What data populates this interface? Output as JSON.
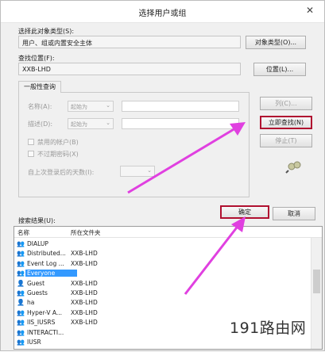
{
  "window": {
    "title": "选择用户或组",
    "close_glyph": "✕"
  },
  "object_type": {
    "label": "选择此对象类型(S):",
    "value": "用户、组或内置安全主体",
    "button": "对象类型(O)..."
  },
  "location": {
    "label": "查找位置(F):",
    "value": "XXB-LHD",
    "button": "位置(L)..."
  },
  "query": {
    "tab_label": "一般性查询",
    "name_label": "名称(A):",
    "name_mode": "起始为",
    "desc_label": "描述(D):",
    "desc_mode": "起始为",
    "disabled_accounts": "禁用的帐户(B)",
    "non_expiring_pw": "不过期密码(X)",
    "days_since_logon": "自上次登录后的天数(I):"
  },
  "side_buttons": {
    "columns": "列(C)...",
    "find_now": "立即查找(N)",
    "stop": "停止(T)"
  },
  "actions": {
    "ok": "确定",
    "cancel": "取消"
  },
  "results": {
    "label": "搜索结果(U):",
    "col_name": "名称",
    "col_folder": "所在文件夹",
    "rows": [
      {
        "name": "DIALUP",
        "folder": "",
        "icon": "group-icon"
      },
      {
        "name": "Distributed...",
        "folder": "XXB-LHD",
        "icon": "group-icon"
      },
      {
        "name": "Event Log ...",
        "folder": "XXB-LHD",
        "icon": "group-icon"
      },
      {
        "name": "Everyone",
        "folder": "",
        "icon": "group-icon",
        "selected": true
      },
      {
        "name": "Guest",
        "folder": "XXB-LHD",
        "icon": "user-icon"
      },
      {
        "name": "Guests",
        "folder": "XXB-LHD",
        "icon": "group-icon"
      },
      {
        "name": "ha",
        "folder": "XXB-LHD",
        "icon": "user-icon"
      },
      {
        "name": "Hyper-V A...",
        "folder": "XXB-LHD",
        "icon": "group-icon"
      },
      {
        "name": "IIS_IUSRS",
        "folder": "XXB-LHD",
        "icon": "group-icon"
      },
      {
        "name": "INTERACTI...",
        "folder": "",
        "icon": "group-icon"
      },
      {
        "name": "IUSR",
        "folder": "",
        "icon": "group-icon"
      }
    ]
  },
  "watermark": "191路由网",
  "colors": {
    "highlight_border": "#b01030",
    "arrow": "#e040e0",
    "selection": "#3399ff"
  }
}
